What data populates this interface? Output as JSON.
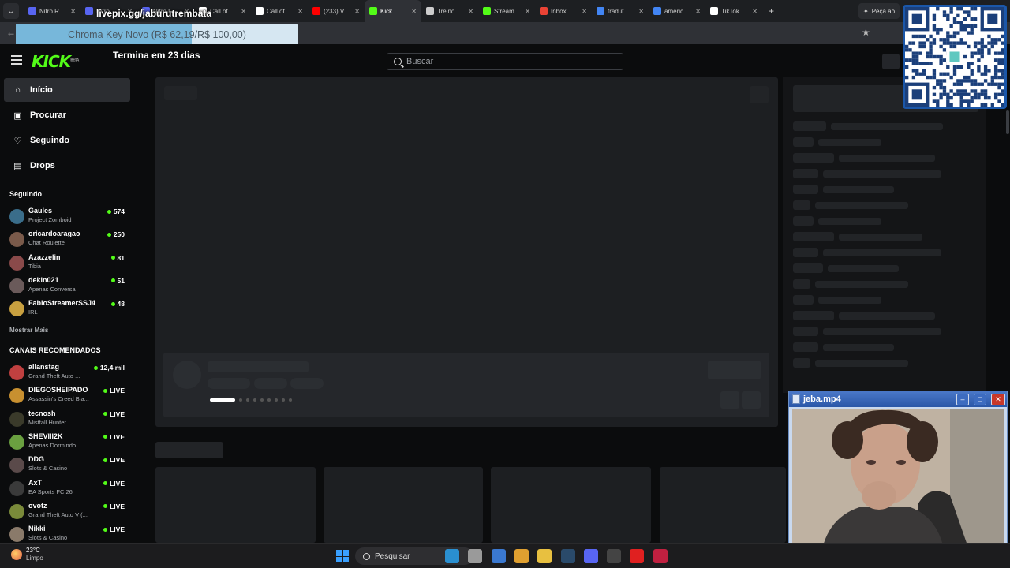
{
  "browser": {
    "tabs": [
      {
        "label": "Nitro R",
        "icon": "discord-icon",
        "color": "#5865f2"
      },
      {
        "label": "Nitro",
        "icon": "discord-icon",
        "color": "#5865f2"
      },
      {
        "label": "Nitro F",
        "icon": "discord-icon",
        "color": "#5865f2"
      },
      {
        "label": "Call of",
        "icon": "activision-icon",
        "color": "#ffffff"
      },
      {
        "label": "Call of",
        "icon": "battlenet-icon",
        "color": "#ffffff"
      },
      {
        "label": "(233) V",
        "icon": "youtube-icon",
        "color": "#ff0000"
      },
      {
        "label": "Kick",
        "icon": "kick-icon",
        "color": "#53fc18"
      },
      {
        "label": "Treino",
        "icon": "chatgpt-icon",
        "color": "#cccccc"
      },
      {
        "label": "Stream",
        "icon": "kick-icon",
        "color": "#53fc18"
      },
      {
        "label": "Inbox",
        "icon": "gmail-icon",
        "color": "#ea4335"
      },
      {
        "label": "tradut",
        "icon": "google-icon",
        "color": "#4285f4"
      },
      {
        "label": "americ",
        "icon": "google-icon",
        "color": "#4285f4"
      },
      {
        "label": "TikTok",
        "icon": "tiktok-icon",
        "color": "#ffffff"
      }
    ],
    "active_tab_index": 6,
    "peca_label": "Peça ao"
  },
  "overlay": {
    "url_text": "livepix.gg/jaburutrembata",
    "goal_text": "Chroma Key Novo (R$ 62,19/R$ 100,00)",
    "goal_fraction": 0.6219
  },
  "header": {
    "logo": "KICK",
    "logo_badge": "BETA",
    "countdown": "Termina em 23 dias",
    "search_placeholder": "Buscar"
  },
  "sidebar": {
    "nav": [
      {
        "label": "Início",
        "icon": "home-icon",
        "glyph": "⌂"
      },
      {
        "label": "Procurar",
        "icon": "browse-icon",
        "glyph": "▣"
      },
      {
        "label": "Seguindo",
        "icon": "heart-icon",
        "glyph": "♡"
      },
      {
        "label": "Drops",
        "icon": "drops-icon",
        "glyph": "▤"
      }
    ],
    "following_title": "Seguindo",
    "following": [
      {
        "name": "Gaules",
        "category": "Project Zomboid",
        "viewers": "574",
        "color": "#3a6d8a"
      },
      {
        "name": "oricardoaragao",
        "category": "Chat Roulette",
        "viewers": "250",
        "color": "#7a5a4a"
      },
      {
        "name": "Azazzelin",
        "category": "Tibia",
        "viewers": "81",
        "color": "#8a4a4a"
      },
      {
        "name": "dekin021",
        "category": "Apenas Conversa",
        "viewers": "51",
        "color": "#6a5a5a"
      },
      {
        "name": "FabioStreamerSSJ4",
        "category": "IRL",
        "viewers": "48",
        "color": "#c8a040"
      }
    ],
    "more_label": "Mostrar Mais",
    "recommended_title": "CANAIS RECOMENDADOS",
    "recommended": [
      {
        "name": "allanstag",
        "category": "Grand Theft Auto ...",
        "viewers": "12,4 mil",
        "color": "#c04040"
      },
      {
        "name": "DIEGOSHEIPADO",
        "category": "Assassin's Creed Bla...",
        "viewers": "LIVE",
        "color": "#c89030"
      },
      {
        "name": "tecnosh",
        "category": "Mistfall Hunter",
        "viewers": "LIVE",
        "color": "#3a3a2a"
      },
      {
        "name": "SHEVIII2K",
        "category": "Apenas Dormindo",
        "viewers": "LIVE",
        "color": "#6aa040"
      },
      {
        "name": "DDG",
        "category": "Slots & Casino",
        "viewers": "LIVE",
        "color": "#5a4a4a"
      },
      {
        "name": "AxT",
        "category": "EA Sports FC 26",
        "viewers": "LIVE",
        "color": "#3a3a3a"
      },
      {
        "name": "ovotz",
        "category": "Grand Theft Auto V (...",
        "viewers": "LIVE",
        "color": "#7a8a3a"
      },
      {
        "name": "Nikki",
        "category": "Slots & Casino",
        "viewers": "LIVE",
        "color": "#8a7a6a"
      }
    ]
  },
  "video_window": {
    "title": "jeba.mp4"
  },
  "taskbar": {
    "temperature": "23°C",
    "condition": "Limpo",
    "search_placeholder": "Pesquisar",
    "apps": [
      {
        "icon": "edge-icon",
        "color": "#2a8fd0"
      },
      {
        "icon": "file-icon",
        "color": "#9a9a9a"
      },
      {
        "icon": "word-icon",
        "color": "#3a78d0"
      },
      {
        "icon": "chrome-icon",
        "color": "#e0a030"
      },
      {
        "icon": "explorer-icon",
        "color": "#e8c040"
      },
      {
        "icon": "steam-icon",
        "color": "#2a4a6a"
      },
      {
        "icon": "discord-icon",
        "color": "#5865f2"
      },
      {
        "icon": "obs-icon",
        "color": "#444444"
      },
      {
        "icon": "youtube-icon",
        "color": "#e02020"
      },
      {
        "icon": "app-icon",
        "color": "#c02040"
      }
    ]
  }
}
